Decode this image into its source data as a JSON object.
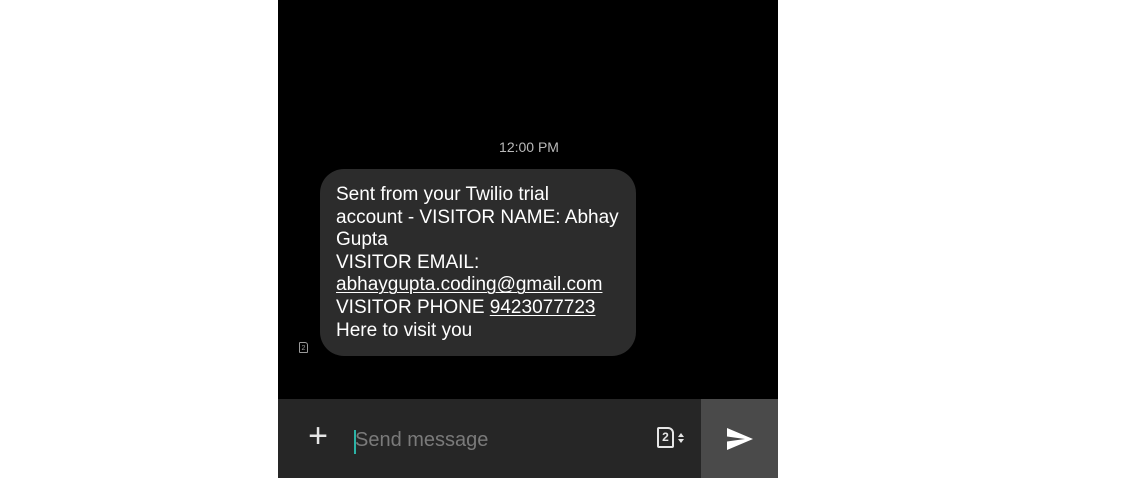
{
  "conversation": {
    "timestamp": "12:00 PM",
    "sim_badge": "2",
    "message": {
      "line1": "Sent from your Twilio trial",
      "line2": "account - VISITOR NAME: Abhay",
      "line3": "Gupta",
      "line4": "VISITOR EMAIL:",
      "email_link": "abhaygupta.coding@gmail.com",
      "phone_prefix": "VISITOR PHONE ",
      "phone_link": "9423077723",
      "line7": "Here to visit you"
    }
  },
  "composer": {
    "add_symbol": "+",
    "placeholder": "Send message",
    "value": "",
    "sim_selected": "2",
    "add_icon": "plus-icon",
    "sim_icon": "sim-card-icon",
    "send_icon": "send-arrow-icon"
  },
  "colors": {
    "background": "#000000",
    "bubble": "#2c2c2c",
    "composer": "#262626",
    "send_button": "#4a4a4a",
    "caret": "#2bb3a6"
  }
}
